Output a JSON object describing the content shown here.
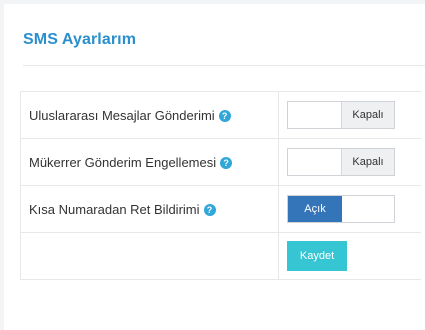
{
  "panel": {
    "title": "SMS Ayarlarım"
  },
  "settings": [
    {
      "label": "Uluslararası Mesajlar Gönderimi",
      "help_icon": "question-circle-icon",
      "help_symbol": "?",
      "state": "off",
      "state_label": "Kapalı"
    },
    {
      "label": "Mükerrer Gönderim Engellemesi",
      "help_icon": "question-circle-icon",
      "help_symbol": "?",
      "state": "off",
      "state_label": "Kapalı"
    },
    {
      "label": "Kısa Numaradan Ret Bildirimi",
      "help_icon": "question-circle-icon",
      "help_symbol": "?",
      "state": "on",
      "state_label": "Açık"
    }
  ],
  "actions": {
    "save_label": "Kaydet"
  },
  "colors": {
    "title": "#2b8fcd",
    "help_icon": "#31a6d9",
    "toggle_on": "#3375b8",
    "toggle_off_bg": "#eef0f2",
    "save_button": "#36c6d3"
  }
}
